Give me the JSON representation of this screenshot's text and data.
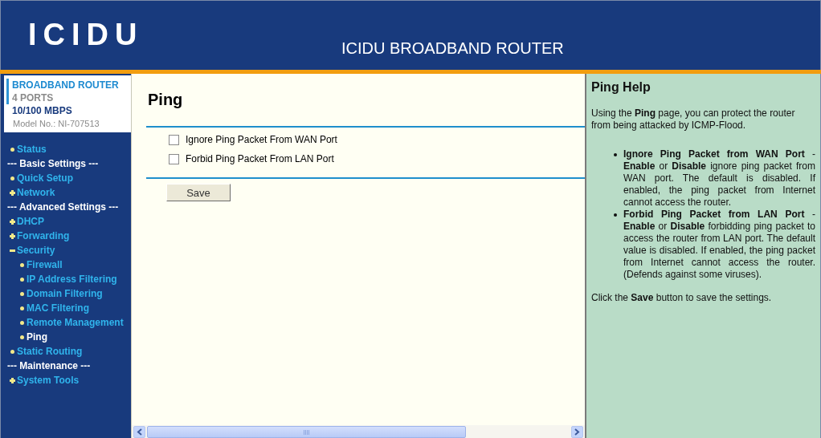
{
  "header": {
    "logo": "ICIDU",
    "title": "ICIDU BROADBAND ROUTER"
  },
  "product": {
    "name": "BROADBAND ROUTER",
    "ports": "4 PORTS",
    "speed": "10/100 MBPS",
    "model": "Model No.: NI-707513"
  },
  "menu": [
    {
      "kind": "link",
      "label": "Status",
      "selected": false
    },
    {
      "kind": "heading",
      "label": "--- Basic Settings ---"
    },
    {
      "kind": "link",
      "label": "Quick Setup",
      "selected": false
    },
    {
      "kind": "group",
      "label": "Network",
      "expanded": false,
      "selected": false
    },
    {
      "kind": "heading",
      "label": "--- Advanced Settings ---"
    },
    {
      "kind": "group",
      "label": "DHCP",
      "expanded": false,
      "selected": false
    },
    {
      "kind": "group",
      "label": "Forwarding",
      "expanded": false,
      "selected": false
    },
    {
      "kind": "group",
      "label": "Security",
      "expanded": true,
      "selected": false,
      "children": [
        {
          "kind": "link",
          "label": "Firewall",
          "selected": false
        },
        {
          "kind": "link",
          "label": "IP Address Filtering",
          "selected": false
        },
        {
          "kind": "link",
          "label": "Domain Filtering",
          "selected": false
        },
        {
          "kind": "link",
          "label": "MAC Filtering",
          "selected": false
        },
        {
          "kind": "link",
          "label": "Remote Management",
          "selected": false
        },
        {
          "kind": "link",
          "label": "Ping",
          "selected": true
        }
      ]
    },
    {
      "kind": "link",
      "label": "Static Routing",
      "selected": false
    },
    {
      "kind": "heading",
      "label": "--- Maintenance ---"
    },
    {
      "kind": "group",
      "label": "System Tools",
      "expanded": false,
      "selected": false
    }
  ],
  "main": {
    "title": "Ping",
    "options": [
      {
        "label": "Ignore Ping Packet From WAN Port",
        "checked": false
      },
      {
        "label": "Forbid Ping Packet From LAN Port",
        "checked": false
      }
    ],
    "save_button": "Save"
  },
  "help": {
    "title": "Ping Help",
    "intro": "Using the **Ping** page, you can protect the router from being attacked by ICMP-Flood.",
    "items": [
      "**Ignore Ping Packet from WAN Port** - **Enable** or **Disable** ignore ping packet from WAN port. The default is disabled. If enabled, the ping packet from Internet cannot access the router.",
      "**Forbid Ping Packet from LAN Port** - **Enable** or **Disable** forbidding ping packet to access the router from LAN port. The default value is disabled. If enabled, the ping packet from Internet cannot access the router. (Defends against some viruses)."
    ],
    "footer": "Click the **Save** button to save the settings."
  }
}
